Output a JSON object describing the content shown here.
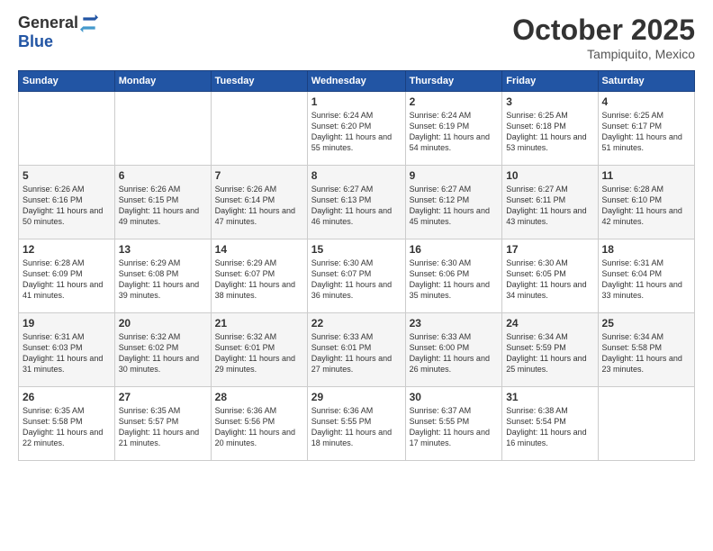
{
  "header": {
    "logo_general": "General",
    "logo_blue": "Blue",
    "month_title": "October 2025",
    "subtitle": "Tampiquito, Mexico"
  },
  "weekdays": [
    "Sunday",
    "Monday",
    "Tuesday",
    "Wednesday",
    "Thursday",
    "Friday",
    "Saturday"
  ],
  "weeks": [
    [
      {
        "day": "",
        "sunrise": "",
        "sunset": "",
        "daylight": ""
      },
      {
        "day": "",
        "sunrise": "",
        "sunset": "",
        "daylight": ""
      },
      {
        "day": "",
        "sunrise": "",
        "sunset": "",
        "daylight": ""
      },
      {
        "day": "1",
        "sunrise": "Sunrise: 6:24 AM",
        "sunset": "Sunset: 6:20 PM",
        "daylight": "Daylight: 11 hours and 55 minutes."
      },
      {
        "day": "2",
        "sunrise": "Sunrise: 6:24 AM",
        "sunset": "Sunset: 6:19 PM",
        "daylight": "Daylight: 11 hours and 54 minutes."
      },
      {
        "day": "3",
        "sunrise": "Sunrise: 6:25 AM",
        "sunset": "Sunset: 6:18 PM",
        "daylight": "Daylight: 11 hours and 53 minutes."
      },
      {
        "day": "4",
        "sunrise": "Sunrise: 6:25 AM",
        "sunset": "Sunset: 6:17 PM",
        "daylight": "Daylight: 11 hours and 51 minutes."
      }
    ],
    [
      {
        "day": "5",
        "sunrise": "Sunrise: 6:26 AM",
        "sunset": "Sunset: 6:16 PM",
        "daylight": "Daylight: 11 hours and 50 minutes."
      },
      {
        "day": "6",
        "sunrise": "Sunrise: 6:26 AM",
        "sunset": "Sunset: 6:15 PM",
        "daylight": "Daylight: 11 hours and 49 minutes."
      },
      {
        "day": "7",
        "sunrise": "Sunrise: 6:26 AM",
        "sunset": "Sunset: 6:14 PM",
        "daylight": "Daylight: 11 hours and 47 minutes."
      },
      {
        "day": "8",
        "sunrise": "Sunrise: 6:27 AM",
        "sunset": "Sunset: 6:13 PM",
        "daylight": "Daylight: 11 hours and 46 minutes."
      },
      {
        "day": "9",
        "sunrise": "Sunrise: 6:27 AM",
        "sunset": "Sunset: 6:12 PM",
        "daylight": "Daylight: 11 hours and 45 minutes."
      },
      {
        "day": "10",
        "sunrise": "Sunrise: 6:27 AM",
        "sunset": "Sunset: 6:11 PM",
        "daylight": "Daylight: 11 hours and 43 minutes."
      },
      {
        "day": "11",
        "sunrise": "Sunrise: 6:28 AM",
        "sunset": "Sunset: 6:10 PM",
        "daylight": "Daylight: 11 hours and 42 minutes."
      }
    ],
    [
      {
        "day": "12",
        "sunrise": "Sunrise: 6:28 AM",
        "sunset": "Sunset: 6:09 PM",
        "daylight": "Daylight: 11 hours and 41 minutes."
      },
      {
        "day": "13",
        "sunrise": "Sunrise: 6:29 AM",
        "sunset": "Sunset: 6:08 PM",
        "daylight": "Daylight: 11 hours and 39 minutes."
      },
      {
        "day": "14",
        "sunrise": "Sunrise: 6:29 AM",
        "sunset": "Sunset: 6:07 PM",
        "daylight": "Daylight: 11 hours and 38 minutes."
      },
      {
        "day": "15",
        "sunrise": "Sunrise: 6:30 AM",
        "sunset": "Sunset: 6:07 PM",
        "daylight": "Daylight: 11 hours and 36 minutes."
      },
      {
        "day": "16",
        "sunrise": "Sunrise: 6:30 AM",
        "sunset": "Sunset: 6:06 PM",
        "daylight": "Daylight: 11 hours and 35 minutes."
      },
      {
        "day": "17",
        "sunrise": "Sunrise: 6:30 AM",
        "sunset": "Sunset: 6:05 PM",
        "daylight": "Daylight: 11 hours and 34 minutes."
      },
      {
        "day": "18",
        "sunrise": "Sunrise: 6:31 AM",
        "sunset": "Sunset: 6:04 PM",
        "daylight": "Daylight: 11 hours and 33 minutes."
      }
    ],
    [
      {
        "day": "19",
        "sunrise": "Sunrise: 6:31 AM",
        "sunset": "Sunset: 6:03 PM",
        "daylight": "Daylight: 11 hours and 31 minutes."
      },
      {
        "day": "20",
        "sunrise": "Sunrise: 6:32 AM",
        "sunset": "Sunset: 6:02 PM",
        "daylight": "Daylight: 11 hours and 30 minutes."
      },
      {
        "day": "21",
        "sunrise": "Sunrise: 6:32 AM",
        "sunset": "Sunset: 6:01 PM",
        "daylight": "Daylight: 11 hours and 29 minutes."
      },
      {
        "day": "22",
        "sunrise": "Sunrise: 6:33 AM",
        "sunset": "Sunset: 6:01 PM",
        "daylight": "Daylight: 11 hours and 27 minutes."
      },
      {
        "day": "23",
        "sunrise": "Sunrise: 6:33 AM",
        "sunset": "Sunset: 6:00 PM",
        "daylight": "Daylight: 11 hours and 26 minutes."
      },
      {
        "day": "24",
        "sunrise": "Sunrise: 6:34 AM",
        "sunset": "Sunset: 5:59 PM",
        "daylight": "Daylight: 11 hours and 25 minutes."
      },
      {
        "day": "25",
        "sunrise": "Sunrise: 6:34 AM",
        "sunset": "Sunset: 5:58 PM",
        "daylight": "Daylight: 11 hours and 23 minutes."
      }
    ],
    [
      {
        "day": "26",
        "sunrise": "Sunrise: 6:35 AM",
        "sunset": "Sunset: 5:58 PM",
        "daylight": "Daylight: 11 hours and 22 minutes."
      },
      {
        "day": "27",
        "sunrise": "Sunrise: 6:35 AM",
        "sunset": "Sunset: 5:57 PM",
        "daylight": "Daylight: 11 hours and 21 minutes."
      },
      {
        "day": "28",
        "sunrise": "Sunrise: 6:36 AM",
        "sunset": "Sunset: 5:56 PM",
        "daylight": "Daylight: 11 hours and 20 minutes."
      },
      {
        "day": "29",
        "sunrise": "Sunrise: 6:36 AM",
        "sunset": "Sunset: 5:55 PM",
        "daylight": "Daylight: 11 hours and 18 minutes."
      },
      {
        "day": "30",
        "sunrise": "Sunrise: 6:37 AM",
        "sunset": "Sunset: 5:55 PM",
        "daylight": "Daylight: 11 hours and 17 minutes."
      },
      {
        "day": "31",
        "sunrise": "Sunrise: 6:38 AM",
        "sunset": "Sunset: 5:54 PM",
        "daylight": "Daylight: 11 hours and 16 minutes."
      },
      {
        "day": "",
        "sunrise": "",
        "sunset": "",
        "daylight": ""
      }
    ]
  ]
}
